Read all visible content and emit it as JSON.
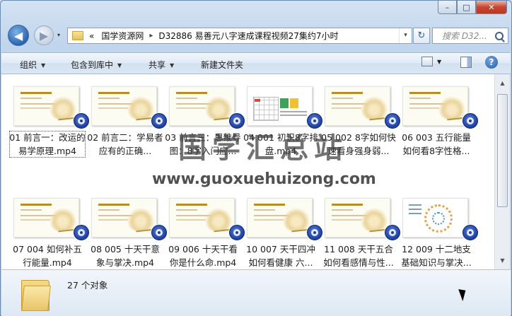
{
  "window": {
    "controls": {
      "min": "–",
      "max": "□",
      "close": "✕"
    }
  },
  "nav": {
    "back_icon": "back-arrow-icon",
    "forward_icon": "forward-arrow-icon",
    "recent_dropdown": "▾"
  },
  "address": {
    "prefix": "«",
    "crumbs": [
      "国学资源网",
      "D32886 易善元八字速成课程视频27集约7小时"
    ],
    "separator": "▸",
    "dropdown": "▾"
  },
  "refresh_symbol": "↻",
  "search": {
    "placeholder": "搜索 D32..."
  },
  "toolbar": {
    "organize": "组织",
    "include_in_library": "包含到库中",
    "share": "共享",
    "new_folder": "新建文件夹",
    "help": "?"
  },
  "files": [
    {
      "name": "01 前言一：改运的易学原理.mp4",
      "thumb": "lotus",
      "focused": true
    },
    {
      "name": "02 前言二：学易者应有的正确...",
      "thumb": "lotus"
    },
    {
      "name": "03 前言三：思维导图：8字入门应...",
      "thumb": "lotus"
    },
    {
      "name": "04 001 初识8字排盘.mp4",
      "thumb": "table"
    },
    {
      "name": "05 002 8字如何快速看身强身弱...",
      "thumb": "lotus"
    },
    {
      "name": "06 003 五行能量如何看8字性格...",
      "thumb": "lotus"
    },
    {
      "name": "07 004 如何补五行能量.mp4",
      "thumb": "lotus"
    },
    {
      "name": "08 005 十天干意象与掌决.mp4",
      "thumb": "lotus"
    },
    {
      "name": "09 006 十天干看你是什么命.mp4",
      "thumb": "lotus"
    },
    {
      "name": "10 007 天干四冲如何看健康 六...",
      "thumb": "lotus"
    },
    {
      "name": "11 008 天干五合如何看感情与性...",
      "thumb": "lotus"
    },
    {
      "name": "12 009 十二地支基础知识与掌决...",
      "thumb": "wheel"
    }
  ],
  "watermark": {
    "title": "国学汇总站",
    "url": "www.guoxuehuizong.com"
  },
  "details": {
    "count": "27 个对象"
  },
  "colors": {
    "accent": "#2d64b0",
    "window": "#c6d9ee",
    "play_icon": "#1d3e9e"
  }
}
